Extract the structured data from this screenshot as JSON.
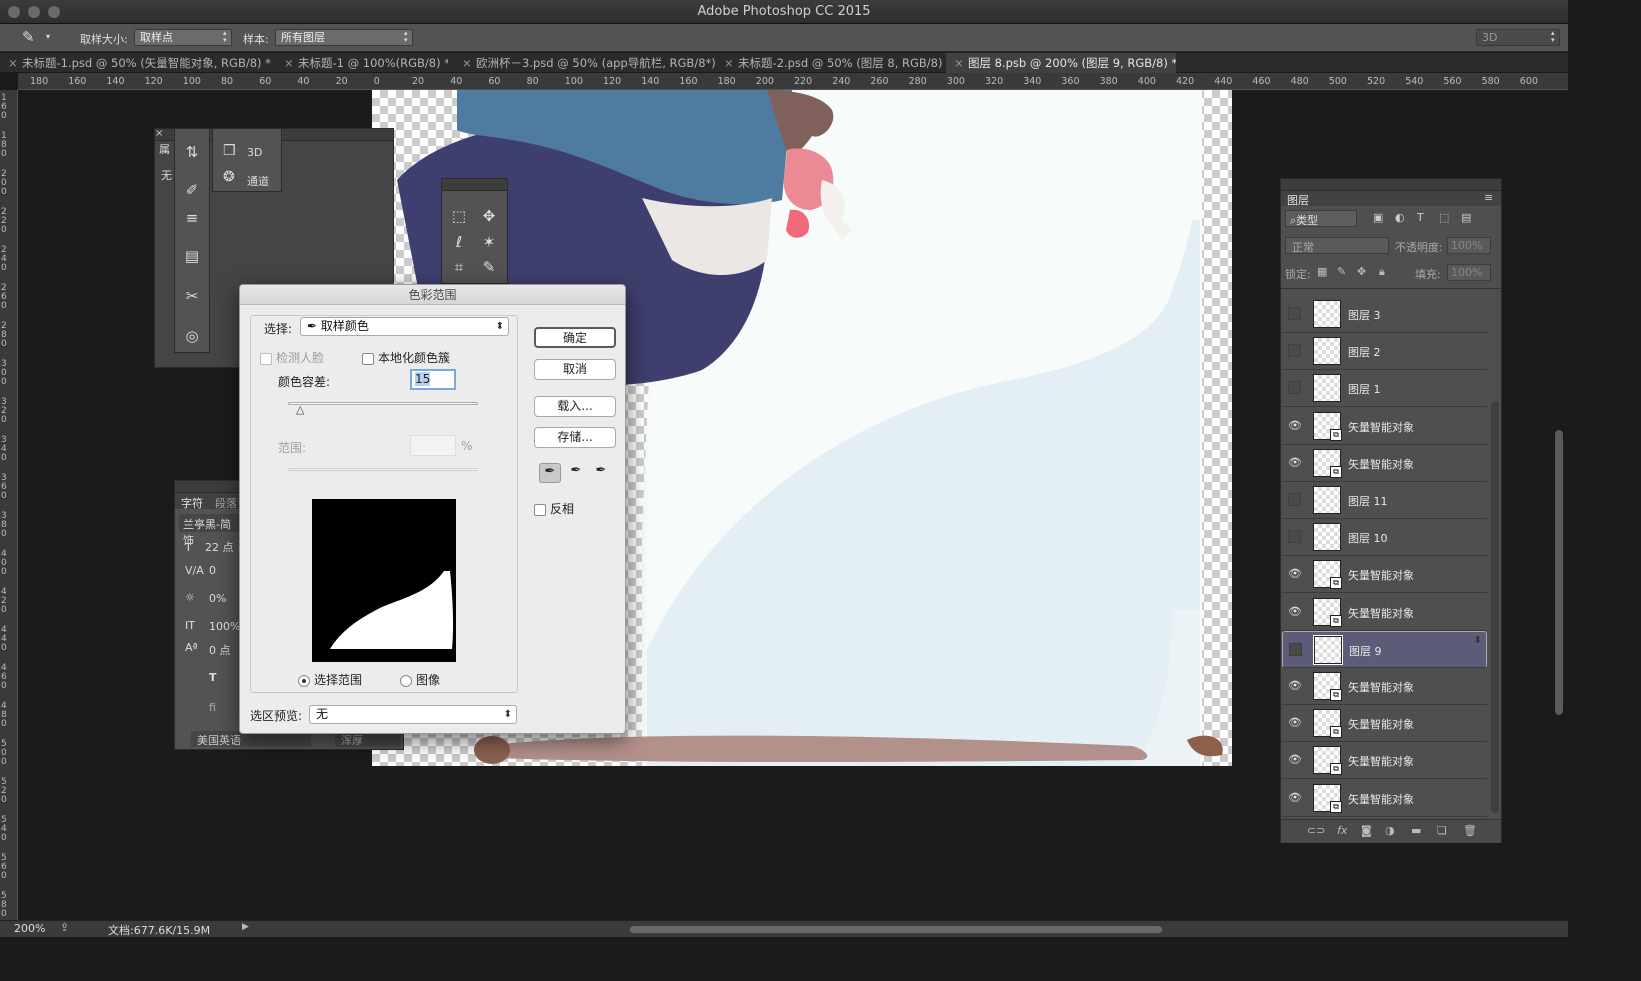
{
  "app": {
    "title": "Adobe Photoshop CC 2015"
  },
  "options_bar": {
    "sample_size_label": "取样大小:",
    "sample_size_value": "取样点",
    "sample_label": "样本:",
    "sample_value": "所有图层",
    "workspace_value": "3D"
  },
  "tabs": [
    {
      "label": "未标题-1.psd @ 50% (矢量智能对象, RGB/8) *"
    },
    {
      "label": "未标题-1 @ 100%(RGB/8) *"
    },
    {
      "label": "欧洲杯－3.psd @ 50% (app导航栏, RGB/8*)"
    },
    {
      "label": "未标题-2.psd @ 50% (图层 8, RGB/8)"
    },
    {
      "label": "图层 8.psb @ 200% (图层 9, RGB/8) *"
    }
  ],
  "ruler_h": [
    "180",
    "160",
    "140",
    "120",
    "100",
    "80",
    "60",
    "40",
    "20",
    "0",
    "20",
    "40",
    "60",
    "80",
    "100",
    "120",
    "140",
    "160",
    "180",
    "200",
    "220",
    "240",
    "260",
    "280",
    "300",
    "320",
    "340",
    "360",
    "380",
    "400",
    "420",
    "440",
    "460",
    "480",
    "500",
    "520",
    "540",
    "560",
    "580",
    "600"
  ],
  "ruler_v": [
    "1 6 0",
    "1 8 0",
    "2 0 0",
    "2 2 0",
    "2 4 0",
    "2 6 0",
    "2 8 0",
    "3 0 0",
    "3 2 0",
    "3 4 0",
    "3 6 0",
    "3 8 0",
    "4 0 0",
    "4 2 0",
    "4 4 0",
    "4 6 0",
    "4 8 0",
    "5 0 0",
    "5 2 0",
    "5 4 0",
    "5 6 0",
    "5 8 0"
  ],
  "mini_panel": {
    "item_3d": "3D",
    "item_channels": "通道",
    "item_left1": "属",
    "item_left2": "无"
  },
  "char_panel": {
    "tab_char": "字符",
    "tab_para": "段落",
    "font": "兰亭黑-简 饰",
    "size": "22 点",
    "tracking": "0",
    "scale": "0%",
    "vscale": "100%",
    "baseline": "0 点",
    "lang": "美国英语",
    "aa": "浑厚"
  },
  "dialog": {
    "title": "色彩范围",
    "select_label": "选择:",
    "select_value": "取样颜色",
    "detect_faces": "检测人脸",
    "localized": "本地化颜色簇",
    "fuzziness_label": "颜色容差:",
    "fuzziness_value": "15",
    "range_label": "范围:",
    "range_unit": "%",
    "radio_selection": "选择范围",
    "radio_image": "图像",
    "preview_label": "选区预览:",
    "preview_value": "无",
    "ok": "确定",
    "cancel": "取消",
    "load": "载入...",
    "save": "存储...",
    "invert": "反相"
  },
  "layers_panel": {
    "title": "图层",
    "filter_kind": "类型",
    "blend_mode": "正常",
    "opacity_label": "不透明度:",
    "opacity_value": "100%",
    "lock_label": "锁定:",
    "fill_label": "填充:",
    "fill_value": "100%",
    "layers": [
      {
        "name": "图层 3",
        "visible": false,
        "smart": false,
        "selected": false
      },
      {
        "name": "图层 2",
        "visible": false,
        "smart": false,
        "selected": false
      },
      {
        "name": "图层 1",
        "visible": false,
        "smart": false,
        "selected": false
      },
      {
        "name": "矢量智能对象",
        "visible": true,
        "smart": true,
        "selected": false
      },
      {
        "name": "矢量智能对象",
        "visible": true,
        "smart": true,
        "selected": false
      },
      {
        "name": "图层 11",
        "visible": false,
        "smart": false,
        "selected": false
      },
      {
        "name": "图层 10",
        "visible": false,
        "smart": false,
        "selected": false
      },
      {
        "name": "矢量智能对象",
        "visible": true,
        "smart": true,
        "selected": false
      },
      {
        "name": "矢量智能对象",
        "visible": true,
        "smart": true,
        "selected": false
      },
      {
        "name": "图层 9",
        "visible": false,
        "smart": false,
        "selected": true
      },
      {
        "name": "矢量智能对象",
        "visible": true,
        "smart": true,
        "selected": false
      },
      {
        "name": "矢量智能对象",
        "visible": true,
        "smart": true,
        "selected": false
      },
      {
        "name": "矢量智能对象",
        "visible": true,
        "smart": true,
        "selected": false
      },
      {
        "name": "矢量智能对象",
        "visible": true,
        "smart": true,
        "selected": false
      }
    ]
  },
  "status": {
    "zoom": "200%",
    "doc": "文档:677.6K/15.9M"
  },
  "colors": {
    "accent_selected_layer": "#5c5c78",
    "canvas_blue": "#4f7ba0",
    "canvas_navy": "#3e3f6e"
  }
}
